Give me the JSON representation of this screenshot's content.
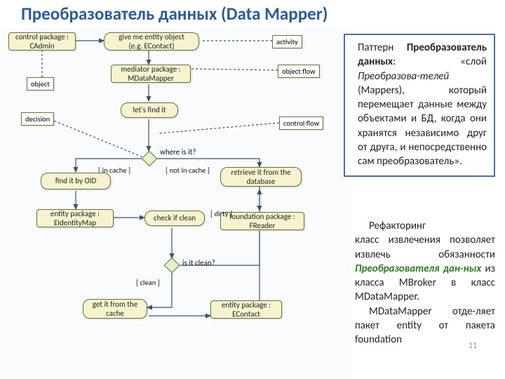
{
  "title": "Преобразователь данных (Data Mapper)",
  "diagram": {
    "control_package": "control package :\nCAdmin",
    "give_entity": "give me entity object\n(e.g. EContact)",
    "mediator_package": "mediator package :\nMDataMapper",
    "lets_find": "let's find it",
    "find_by_oid": "find it by OID",
    "entity_package": "entity package :\nEIdentityMap",
    "check_clean": "check if clean",
    "get_cache": "get it from the\ncache",
    "retrieve_db": "retrieve it from the\ndatabase",
    "foundation_package": "foundation package :\nFReader",
    "entity_econtact": "entity package :\nEContact",
    "note_object": "object",
    "note_decision": "decision",
    "note_activity": "activity",
    "note_object_flow": "object flow",
    "note_control_flow": "control flow",
    "q_where": "where is it?",
    "q_clean": "is it clean?",
    "g_in_cache": "[ in cache ]",
    "g_not_in_cache": "[ not in cache ]",
    "g_dirty": "[ dirty ]",
    "g_clean": "[ clean ]"
  },
  "info": {
    "p1_a": "Паттерн ",
    "p1_b": "Преобразователь данных",
    "p1_c": ": «слой ",
    "p1_d": "Преобразова-телей",
    "p1_e": " (Mappers), который перемещает данные между объектами и БД, когда они хранятся независимо друг от друга, и непосредственно сам преобразователь».",
    "p2_a": "Рефакторинг ",
    "p2_b": "класс извлечения",
    "p2_c": " позволяет извлечь обязанности ",
    "p2_d": "Преобразователя дан-ных",
    "p2_e": " из класса MBroker в класс MDataMapper.",
    "p3": "MDataMapper отде-ляет пакет entity от пакета foundation"
  },
  "pagenum": "11"
}
